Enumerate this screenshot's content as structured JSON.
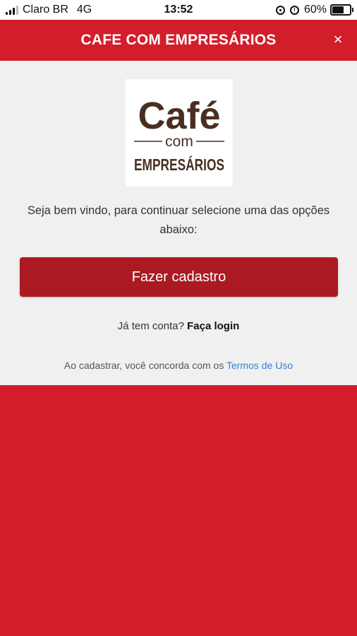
{
  "status_bar": {
    "carrier": "Claro BR",
    "network": "4G",
    "time": "13:52",
    "battery": "60%"
  },
  "header": {
    "title": "CAFE COM EMPRESÁRIOS",
    "close_label": "×"
  },
  "logo": {
    "line1": "Café",
    "line2": "com",
    "line3": "EMPRESÁRIOS"
  },
  "main": {
    "welcome_text": "Seja bem vindo, para continuar selecione uma das opções abaixo:",
    "signup_button_label": "Fazer cadastro",
    "login_prompt": "Já tem conta?",
    "login_link_label": "Faça login",
    "terms_prefix": "Ao cadastrar, você concorda com os",
    "terms_link_label": "Termos de Uso"
  },
  "colors": {
    "brand_red": "#d21e2b",
    "button_red": "#ab1a22",
    "logo_brown": "#4a2e22",
    "link_blue": "#3a7fd6"
  }
}
